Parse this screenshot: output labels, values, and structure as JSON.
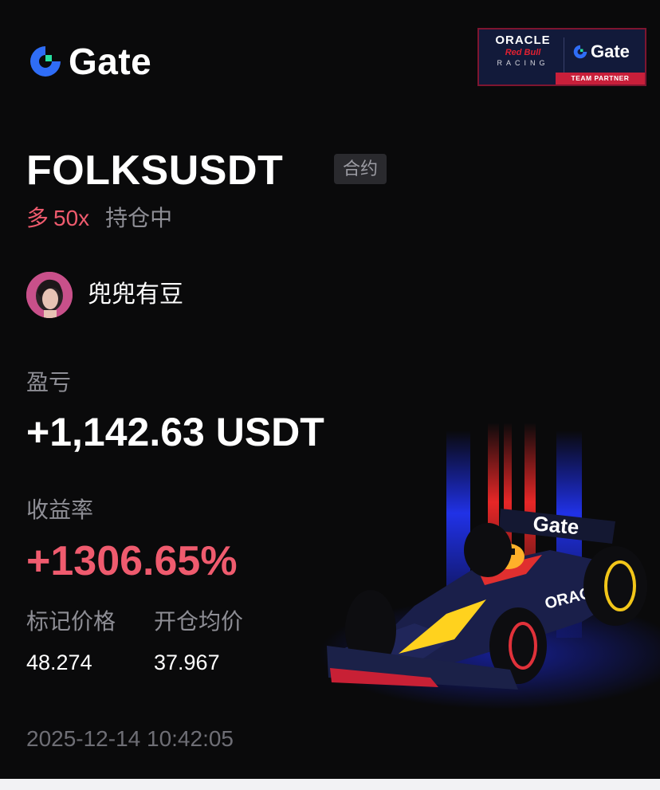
{
  "brand": {
    "name": "Gate"
  },
  "partner": {
    "oracle": "ORACLE",
    "redbull": "Red Bull",
    "racing": "RACING",
    "gate": "Gate",
    "team_partner": "TEAM PARTNER"
  },
  "position": {
    "symbol": "FOLKSUSDT",
    "tag": "合约",
    "side": "多",
    "leverage": "50x",
    "status": "持仓中"
  },
  "user": {
    "name": "兜兜有豆"
  },
  "pnl": {
    "label": "盈亏",
    "value": "+1,142.63 USDT"
  },
  "roi": {
    "label": "收益率",
    "value": "+1306.65%"
  },
  "prices": {
    "mark_label": "标记价格",
    "mark_value": "48.274",
    "entry_label": "开仓均价",
    "entry_value": "37.967"
  },
  "timestamp": "2025-12-14 10:42:05",
  "car": {
    "livery_text": "Gate",
    "sidepod_text": "ORACLE"
  },
  "colors": {
    "background": "#0a0a0b",
    "accent_red": "#ef5b6e",
    "muted_gray": "#8e8e95",
    "gate_blue": "#2f6df6",
    "gate_green": "#26e0a0"
  },
  "icons": [
    "gate-logo-icon",
    "avatar-image",
    "f1-car-illustration"
  ]
}
